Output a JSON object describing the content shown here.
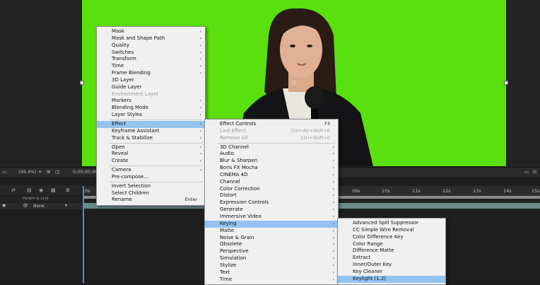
{
  "viewer": {
    "zoom": "(49.4%)",
    "timecode": "0;00;00;00"
  },
  "timeline": {
    "ticks": [
      "0s",
      "09s",
      "10s",
      "11s",
      "12s",
      "13s",
      "14s",
      "15s"
    ],
    "column_header": "Parent & Link",
    "parent_value": "None"
  },
  "layer_menu": [
    {
      "label": "Mask",
      "arrow": true
    },
    {
      "label": "Mask and Shape Path",
      "arrow": true
    },
    {
      "label": "Quality",
      "arrow": true
    },
    {
      "label": "Switches",
      "arrow": true
    },
    {
      "label": "Transform",
      "arrow": true
    },
    {
      "label": "Time",
      "arrow": true
    },
    {
      "label": "Frame Blending",
      "arrow": true
    },
    {
      "label": "3D Layer"
    },
    {
      "label": "Guide Layer"
    },
    {
      "label": "Environment Layer",
      "disabled": true
    },
    {
      "label": "Markers",
      "arrow": true
    },
    {
      "label": "Blending Mode",
      "arrow": true
    },
    {
      "label": "Layer Styles",
      "arrow": true
    },
    {
      "sep": true
    },
    {
      "label": "Effect",
      "arrow": true,
      "highlight": true
    },
    {
      "label": "Keyframe Assistant",
      "arrow": true
    },
    {
      "label": "Track & Stabilize",
      "arrow": true
    },
    {
      "sep": true
    },
    {
      "label": "Open",
      "arrow": true
    },
    {
      "label": "Reveal",
      "arrow": true
    },
    {
      "label": "Create",
      "arrow": true
    },
    {
      "sep": true
    },
    {
      "label": "Camera",
      "arrow": true
    },
    {
      "label": "Pre-compose..."
    },
    {
      "sep": true
    },
    {
      "label": "Invert Selection"
    },
    {
      "label": "Select Children"
    },
    {
      "label": "Rename",
      "shortcut": "Enter"
    }
  ],
  "effect_menu": [
    {
      "label": "Effect Controls",
      "shortcut": "F3"
    },
    {
      "label": "Last Effect",
      "shortcut": "Ctrl+Alt+Shift+E",
      "disabled": true
    },
    {
      "label": "Remove All",
      "shortcut": "Ctrl+Shift+E",
      "disabled": true
    },
    {
      "sep": true
    },
    {
      "label": "3D Channel",
      "arrow": true
    },
    {
      "label": "Audio",
      "arrow": true
    },
    {
      "label": "Blur & Sharpen",
      "arrow": true
    },
    {
      "label": "Boris FX Mocha",
      "arrow": true
    },
    {
      "label": "CINEMA 4D",
      "arrow": true
    },
    {
      "label": "Channel",
      "arrow": true
    },
    {
      "label": "Color Correction",
      "arrow": true
    },
    {
      "label": "Distort",
      "arrow": true
    },
    {
      "label": "Expression Controls",
      "arrow": true
    },
    {
      "label": "Generate",
      "arrow": true
    },
    {
      "label": "Immersive Video",
      "arrow": true
    },
    {
      "label": "Keying",
      "arrow": true,
      "highlight": true
    },
    {
      "label": "Matte",
      "arrow": true
    },
    {
      "label": "Noise & Grain",
      "arrow": true
    },
    {
      "label": "Obsolete",
      "arrow": true
    },
    {
      "label": "Perspective",
      "arrow": true
    },
    {
      "label": "Simulation",
      "arrow": true
    },
    {
      "label": "Stylize",
      "arrow": true
    },
    {
      "label": "Text",
      "arrow": true
    },
    {
      "label": "Time",
      "arrow": true
    }
  ],
  "keying_menu": [
    {
      "label": "Advanced Spill Suppressor"
    },
    {
      "label": "CC Simple Wire Removal"
    },
    {
      "label": "Color Difference Key"
    },
    {
      "label": "Color Range"
    },
    {
      "label": "Difference Matte"
    },
    {
      "label": "Extract"
    },
    {
      "label": "Inner/Outer Key"
    },
    {
      "label": "Key Cleaner"
    },
    {
      "label": "Keylight (1.2)",
      "highlight": true
    }
  ],
  "colors": {
    "screen_green": "#5ae00c",
    "menu_highlight": "#93c3f0",
    "playhead": "#4d8ddd"
  }
}
